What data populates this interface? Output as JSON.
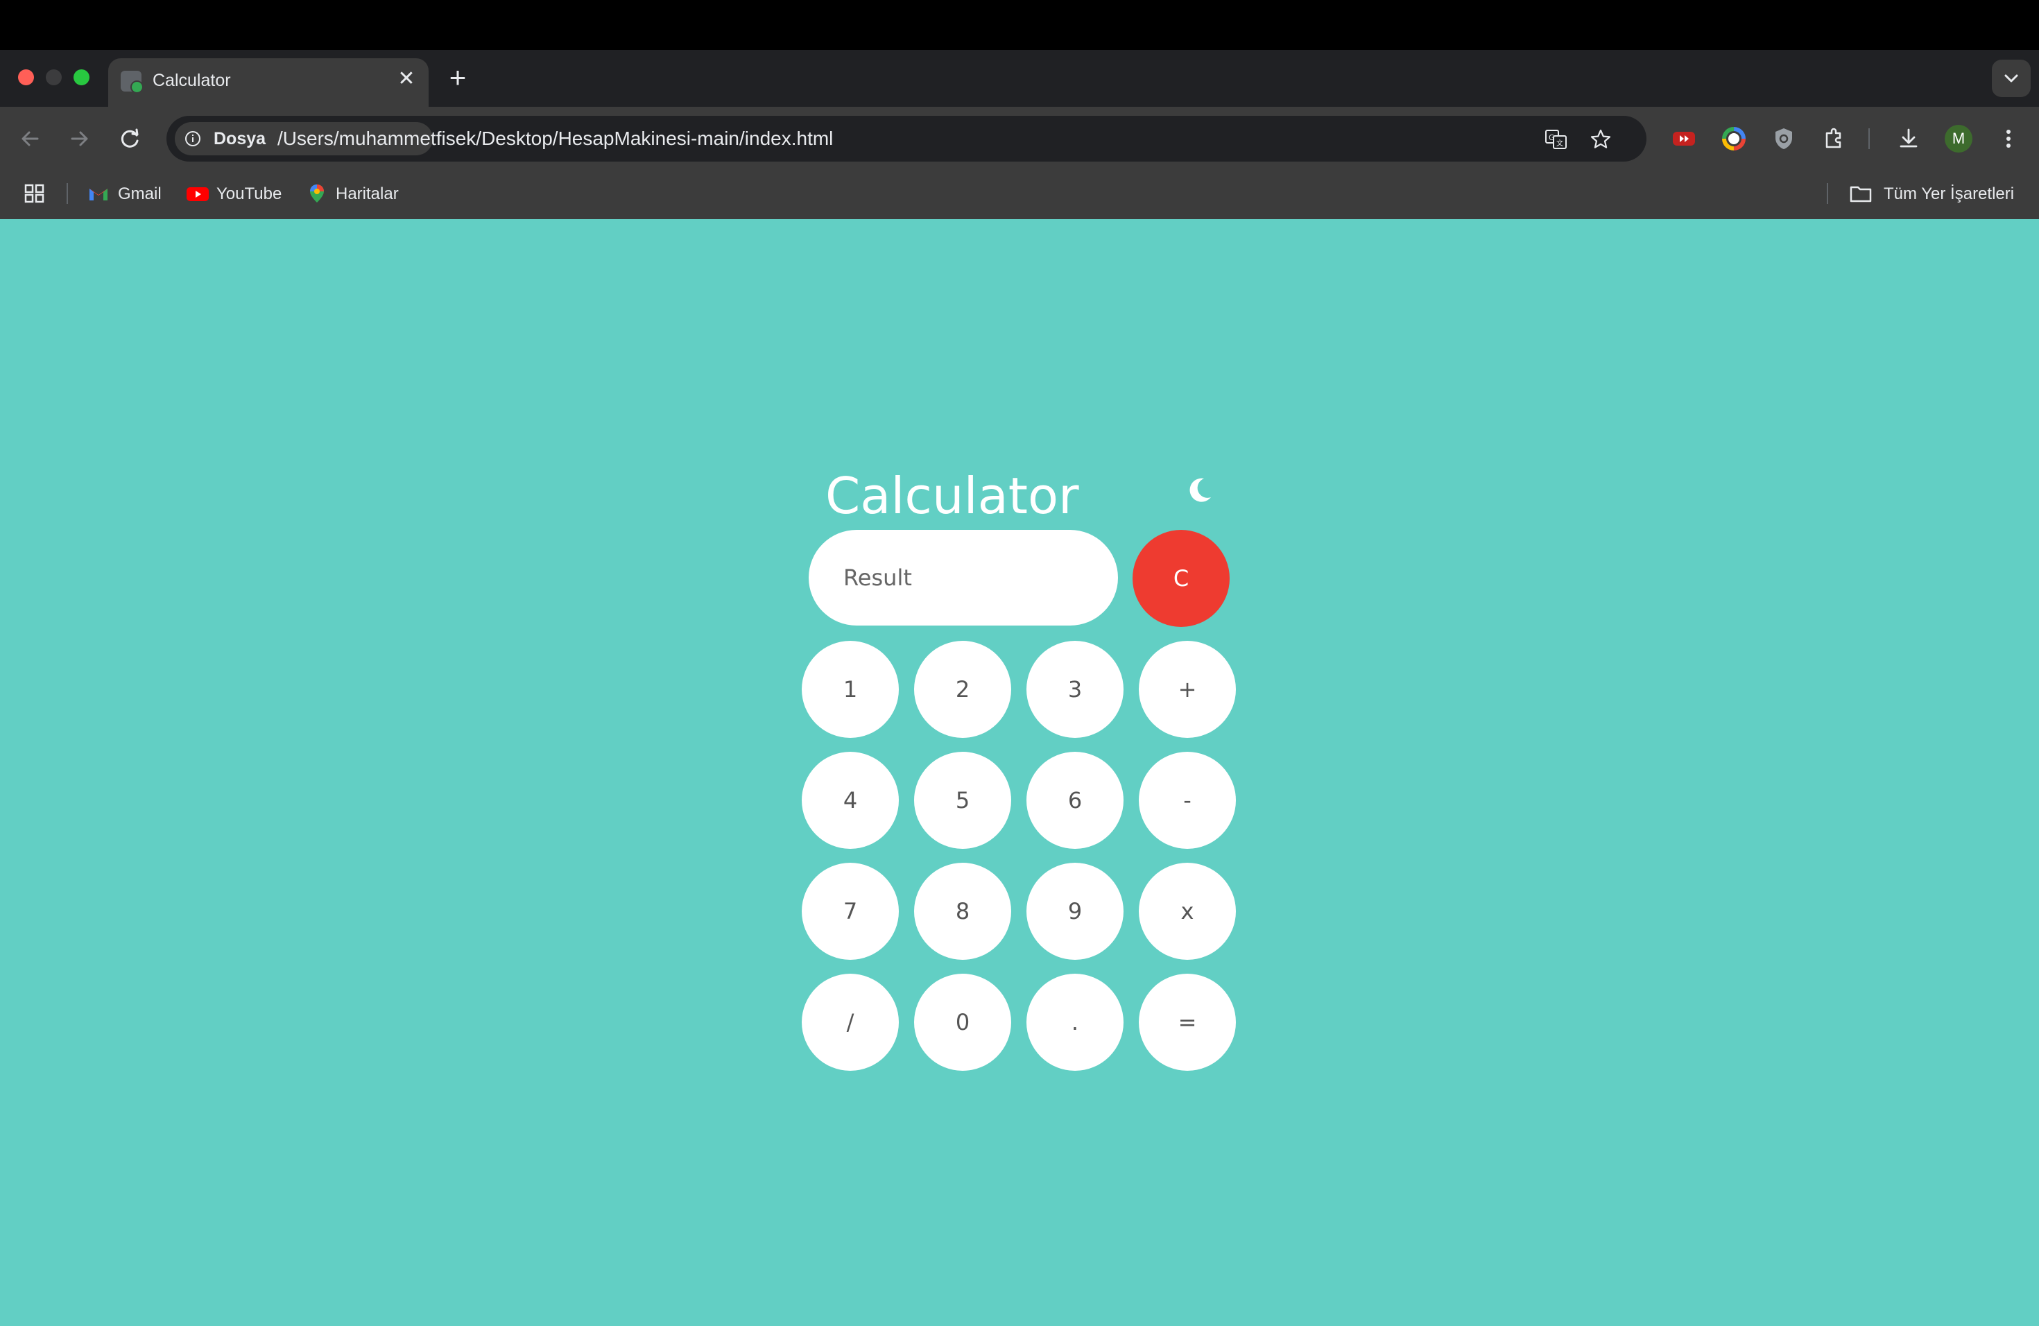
{
  "browser": {
    "tab": {
      "title": "Calculator",
      "close": "✕"
    },
    "new_tab": "+",
    "omnibox": {
      "chip_label": "Dosya",
      "url": "/Users/muhammetfisek/Desktop/HesapMakinesi-main/index.html"
    },
    "avatar_letter": "M",
    "bookmarks": [
      {
        "label": "Gmail",
        "icon": "gmail-icon"
      },
      {
        "label": "YouTube",
        "icon": "youtube-icon"
      },
      {
        "label": "Haritalar",
        "icon": "maps-icon"
      }
    ],
    "all_bookmarks": "Tüm Yer İşaretleri"
  },
  "calculator": {
    "title": "Calculator",
    "result_placeholder": "Result",
    "clear_label": "C",
    "keys": [
      "1",
      "2",
      "3",
      "+",
      "4",
      "5",
      "6",
      "-",
      "7",
      "8",
      "9",
      "x",
      "/",
      "0",
      ".",
      "="
    ]
  },
  "colors": {
    "page_bg": "#62cfc4",
    "clear_button": "#ee3b30",
    "button": "#ffffff",
    "button_text": "#555555"
  }
}
